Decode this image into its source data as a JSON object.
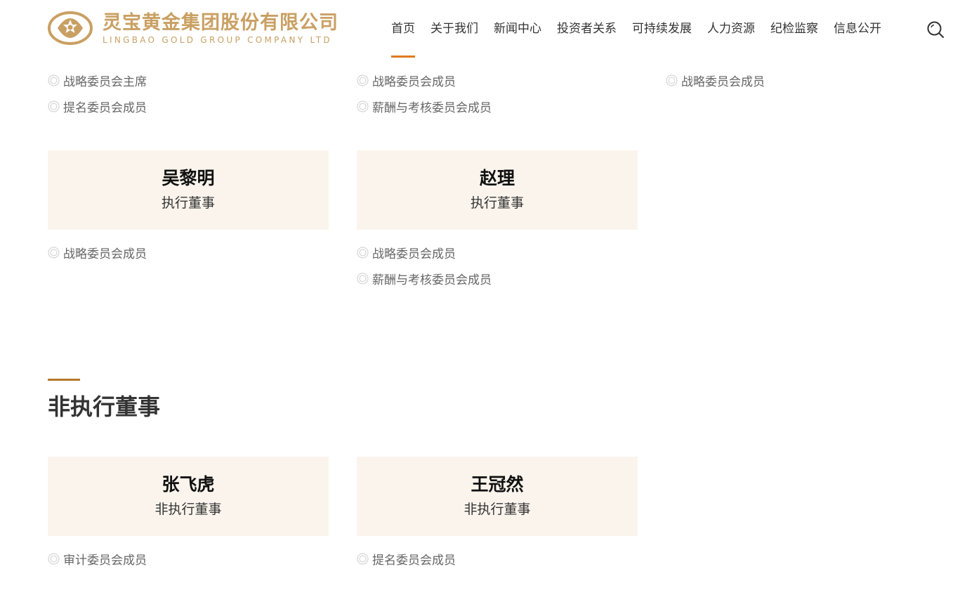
{
  "header": {
    "logo_cn": "灵宝黄金集团股份有限公司",
    "logo_en": "LINGBAO GOLD GROUP COMPANY LTD",
    "nav": [
      "首页",
      "关于我们",
      "新闻中心",
      "投资者关系",
      "可持续发展",
      "人力资源",
      "纪检监察",
      "信息公开"
    ],
    "active_nav": "首页",
    "search_icon": "search-icon"
  },
  "colors": {
    "brand_gold": "#c9a063",
    "active_underline": "#e07a1f",
    "section_bar": "#b5792a",
    "card_bg": "#faf4ec"
  },
  "top_row_roles": {
    "col1": [
      "战略委员会主席",
      "提名委员会成员"
    ],
    "col2": [
      "战略委员会成员",
      "薪酬与考核委员会成员"
    ],
    "col3": [
      "战略委员会成员"
    ]
  },
  "executive_directors": [
    {
      "name": "吴黎明",
      "title": "执行董事",
      "roles": [
        "战略委员会成员"
      ]
    },
    {
      "name": "赵理",
      "title": "执行董事",
      "roles": [
        "战略委员会成员",
        "薪酬与考核委员会成员"
      ]
    }
  ],
  "non_executive_section": {
    "title": "非执行董事",
    "people": [
      {
        "name": "张飞虎",
        "title": "非执行董事",
        "roles": [
          "审计委员会成员"
        ]
      },
      {
        "name": "王冠然",
        "title": "非执行董事",
        "roles": [
          "提名委员会成员"
        ]
      }
    ]
  }
}
